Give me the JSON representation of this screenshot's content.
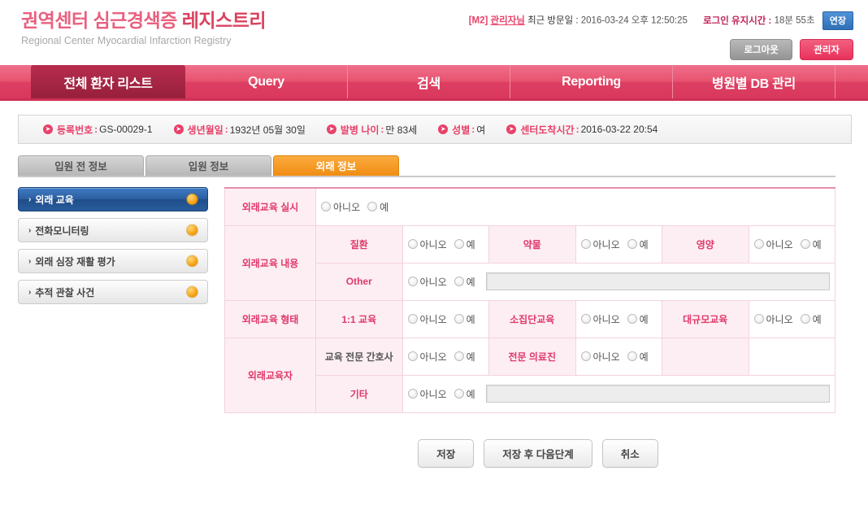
{
  "header": {
    "title_ko_part1": "권역센터 심근경색증 ",
    "title_ko_part2": "레지스트리",
    "title_en": "Regional Center Myocardial Infarction Registry",
    "session_tag": "[M2]",
    "user_name": "관리자님",
    "last_visit_label": "최근 방문일 :",
    "last_visit_value": "2016-03-24 오후 12:50:25",
    "login_keep_label": "로그인 유지시간 :",
    "login_keep_value": "18분 55초",
    "extend_button": "연장",
    "logout_button": "로그아웃",
    "admin_button": "관리자",
    "accent_color": "#e8416a",
    "extend_color": "#2f6fb5"
  },
  "nav": {
    "items": [
      {
        "label": "전체 환자 리스트",
        "active": true
      },
      {
        "label": "Query",
        "active": false
      },
      {
        "label": "검색",
        "active": false
      },
      {
        "label": "Reporting",
        "active": false
      },
      {
        "label": "병원별 DB 관리",
        "active": false
      }
    ]
  },
  "patient": {
    "items": [
      {
        "key": "등록번호",
        "value": "GS-00029-1"
      },
      {
        "key": "생년월일",
        "value": "1932년 05월 30일"
      },
      {
        "key": "발병 나이",
        "value": "만 83세"
      },
      {
        "key": "성별",
        "value": "여"
      },
      {
        "key": "센터도착시간",
        "value": "2016-03-22 20:54"
      }
    ]
  },
  "tabs": [
    {
      "label": "입원 전 정보",
      "active": false
    },
    {
      "label": "입원 정보",
      "active": false
    },
    {
      "label": "외래 정보",
      "active": true
    }
  ],
  "sidebar": {
    "items": [
      {
        "label": "외래 교육",
        "active": true
      },
      {
        "label": "전화모니터링",
        "active": false
      },
      {
        "label": "외래 심장 재활 평가",
        "active": false
      },
      {
        "label": "추적 관찰 사건",
        "active": false
      }
    ],
    "chevron": "›"
  },
  "form": {
    "radio_no": "아니오",
    "radio_yes": "예",
    "rows": {
      "edu_performed_label": "외래교육 실시",
      "edu_content_label": "외래교육 내용",
      "edu_content_items": [
        {
          "label": "질환"
        },
        {
          "label": "약물"
        },
        {
          "label": "영양"
        }
      ],
      "edu_content_other_label": "Other",
      "edu_content_other_value": "",
      "edu_type_label": "외래교육 형태",
      "edu_type_items": [
        {
          "label": "1:1 교육"
        },
        {
          "label": "소집단교육"
        },
        {
          "label": "대규모교육"
        }
      ],
      "edu_person_label": "외래교육자",
      "edu_person_items": [
        {
          "label": "교육 전문 간호사"
        },
        {
          "label": "전문 의료진"
        }
      ],
      "edu_person_other_label": "기타",
      "edu_person_other_value": ""
    }
  },
  "footer": {
    "save": "저장",
    "save_next": "저장 후 다음단계",
    "cancel": "취소"
  }
}
